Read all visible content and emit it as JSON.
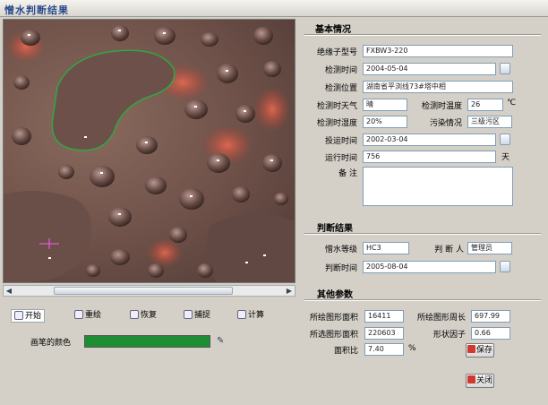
{
  "window": {
    "title": "憎水判断结果"
  },
  "toolbar": {
    "start": "开始",
    "clear": "重绘",
    "restore": "恢复",
    "capture": "捕捉",
    "compute": "计算"
  },
  "color_row": {
    "label": "画笔的颜色",
    "color": "#1e8e35"
  },
  "basic": {
    "heading": "基本情况",
    "model_label": "绝缘子型号",
    "model_value": "FXBW3-220",
    "detect_date_label": "检测时间",
    "detect_date_value": "2004-05-04",
    "location_label": "检测位置",
    "location_value": "湖南省平浏线73#塔中相",
    "weather_label": "检测时天气",
    "weather_value": "晴",
    "temp_label": "检测时温度",
    "temp_value": "26",
    "temp_unit": "℃",
    "humidity_label": "检测时湿度",
    "humidity_value": "20%",
    "pollution_label": "污染情况",
    "pollution_value": "三级污区",
    "commission_label": "投运时间",
    "commission_value": "2002-03-04",
    "runtime_label": "运行时间",
    "runtime_value": "756",
    "runtime_unit": "天",
    "remark_label": "备 注",
    "remark_value": ""
  },
  "judge": {
    "heading": "判断结果",
    "level_label": "憎水等级",
    "level_value": "HC3",
    "judge_person_label": "判 断 人",
    "judge_person_value": "管理员",
    "judge_time_label": "判断时间",
    "judge_time_value": "2005-08-04"
  },
  "other": {
    "heading": "其他参数",
    "area_label": "所绘图形面积",
    "area_value": "16411",
    "perimeter_label": "所绘图形周长",
    "perimeter_value": "697.99",
    "selected_area_label": "所选图形面积",
    "selected_area_value": "220603",
    "shape_factor_label": "形状因子",
    "shape_factor_value": "0.66",
    "area_ratio_label": "面积比",
    "area_ratio_value": "7.40",
    "area_ratio_unit": "%"
  },
  "buttons": {
    "save": "保存",
    "close": "关闭"
  },
  "image_pane": {
    "subject": "water-droplets-on-insulator-surface"
  }
}
